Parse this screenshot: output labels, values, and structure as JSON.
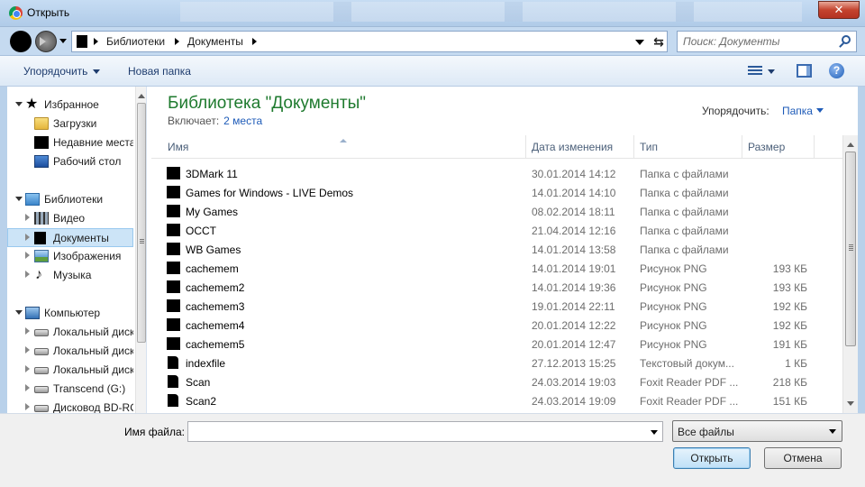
{
  "window": {
    "title": "Открыть",
    "close_label": "✕"
  },
  "address": {
    "crumbs": [
      "Библиотеки",
      "Документы"
    ],
    "search_placeholder": "Поиск: Документы",
    "refresh_glyph": "⇆"
  },
  "toolbar": {
    "organize": "Упорядочить",
    "new_folder": "Новая папка",
    "help": "?"
  },
  "nav": {
    "items": [
      {
        "label": "Избранное"
      },
      {
        "label": "Загрузки"
      },
      {
        "label": "Недавние места"
      },
      {
        "label": "Рабочий стол"
      },
      {
        "label": "Библиотеки"
      },
      {
        "label": "Видео"
      },
      {
        "label": "Документы"
      },
      {
        "label": "Изображения"
      },
      {
        "label": "Музыка"
      },
      {
        "label": "Компьютер"
      },
      {
        "label": "Локальный диск"
      },
      {
        "label": "Локальный диск"
      },
      {
        "label": "Локальный диск"
      },
      {
        "label": "Transcend (G:)"
      },
      {
        "label": "Дисковод BD-RO"
      }
    ],
    "star_glyph": "★",
    "music_glyph": "♪"
  },
  "library": {
    "title": "Библиотека \"Документы\"",
    "includes_label": "Включает:",
    "includes_link": "2 места",
    "arrange_label": "Упорядочить:",
    "arrange_value": "Папка"
  },
  "columns": {
    "name": "Имя",
    "date": "Дата изменения",
    "type": "Тип",
    "size": "Размер"
  },
  "files": [
    {
      "name": "3DMark 11",
      "date": "30.01.2014 14:12",
      "type": "Папка с файлами",
      "size": ""
    },
    {
      "name": "Games for Windows - LIVE Demos",
      "date": "14.01.2014 14:10",
      "type": "Папка с файлами",
      "size": ""
    },
    {
      "name": "My Games",
      "date": "08.02.2014 18:11",
      "type": "Папка с файлами",
      "size": ""
    },
    {
      "name": "OCCT",
      "date": "21.04.2014 12:16",
      "type": "Папка с файлами",
      "size": ""
    },
    {
      "name": "WB Games",
      "date": "14.01.2014 13:58",
      "type": "Папка с файлами",
      "size": ""
    },
    {
      "name": "cachemem",
      "date": "14.01.2014 19:01",
      "type": "Рисунок PNG",
      "size": "193 КБ"
    },
    {
      "name": "cachemem2",
      "date": "14.01.2014 19:36",
      "type": "Рисунок PNG",
      "size": "193 КБ"
    },
    {
      "name": "cachemem3",
      "date": "19.01.2014 22:11",
      "type": "Рисунок PNG",
      "size": "192 КБ"
    },
    {
      "name": "cachemem4",
      "date": "20.01.2014 12:22",
      "type": "Рисунок PNG",
      "size": "192 КБ"
    },
    {
      "name": "cachemem5",
      "date": "20.01.2014 12:47",
      "type": "Рисунок PNG",
      "size": "191 КБ"
    },
    {
      "name": "indexfile",
      "date": "27.12.2013 15:25",
      "type": "Текстовый докум...",
      "size": "1 КБ"
    },
    {
      "name": "Scan",
      "date": "24.03.2014 19:03",
      "type": "Foxit Reader PDF ...",
      "size": "218 КБ"
    },
    {
      "name": "Scan2",
      "date": "24.03.2014 19:09",
      "type": "Foxit Reader PDF ...",
      "size": "151 КБ"
    }
  ],
  "bottom": {
    "filename_label": "Имя файла:",
    "filename_value": "",
    "filter_value": "Все файлы",
    "open_label": "Открыть",
    "cancel_label": "Отмена"
  }
}
